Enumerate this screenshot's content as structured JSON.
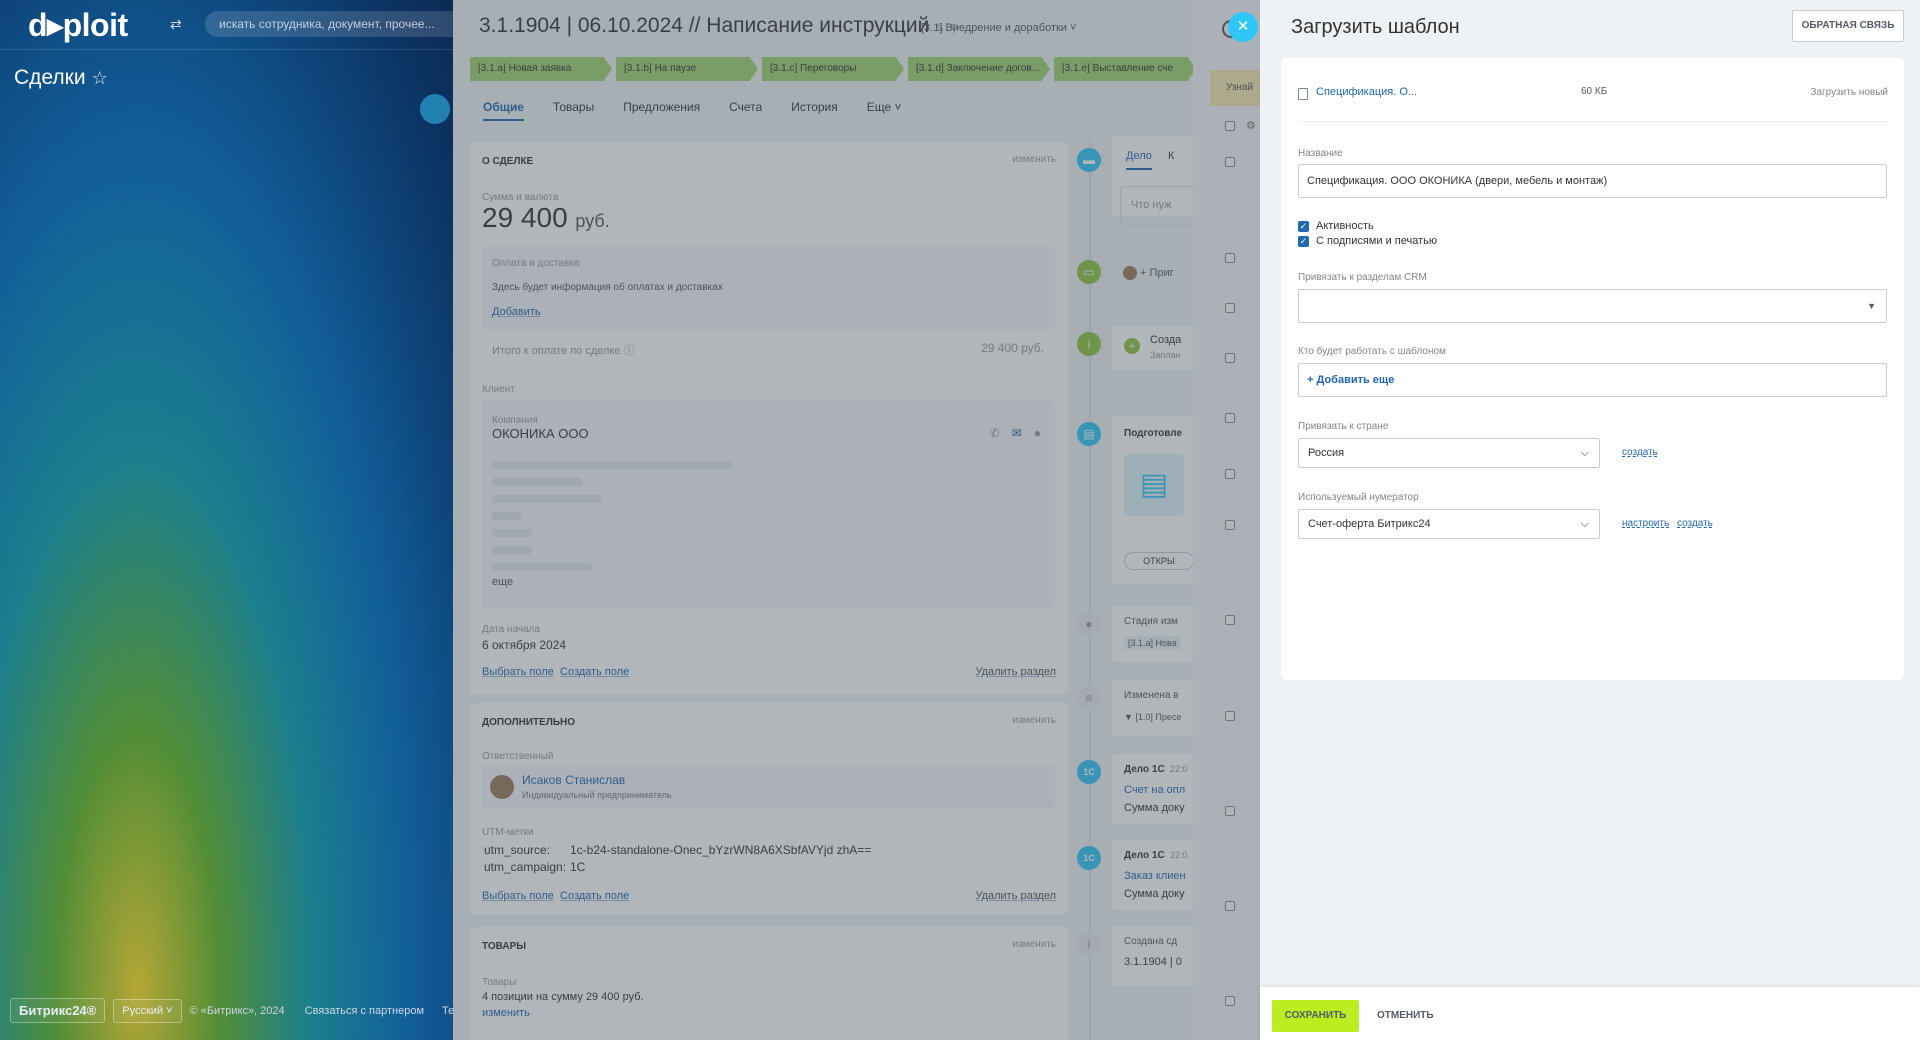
{
  "left": {
    "logo": "d▸ploit",
    "search_placeholder": "искать сотрудника, документ, прочее...",
    "page_title": "Сделки",
    "footer": {
      "brand": "Битрикс24®",
      "lang": "Русский",
      "copyright": "© «Битрикс», 2024",
      "partner": "Связаться с партнером",
      "more": "Тех"
    }
  },
  "deal": {
    "title": "3.1.1904 | 06.10.2024 // Написание инструкций",
    "category": "[3.1] Внедрение и доработки",
    "stages": [
      "[3.1.a] Новая заявка",
      "[3.1.b] На паузе",
      "[3.1.c] Переговоры",
      "[3.1.d] Заключение догов...",
      "[3.1.e] Выставление сче"
    ],
    "tabs": [
      "Общие",
      "Товары",
      "Предложения",
      "Счета",
      "История",
      "Еще"
    ],
    "about": {
      "header": "О СДЕЛКЕ",
      "edit": "изменить",
      "sum_label": "Сумма и валюта",
      "sum_value": "29 400",
      "sum_currency": "руб.",
      "payment_label": "Оплата и доставка",
      "payment_text": "Здесь будет информация об оплатах и доставках",
      "payment_add": "Добавить",
      "total_label": "Итого к оплате по сделке",
      "total_value": "29 400 руб.",
      "client_label": "Клиент",
      "company_label": "Компания",
      "company_name": "ОКОНИКА ООО",
      "more": "еще",
      "start_label": "Дата начала",
      "start_value": "6 октября 2024",
      "choose_field": "Выбрать поле",
      "create_field": "Создать поле",
      "delete_section": "Удалить раздел"
    },
    "extra": {
      "header": "ДОПОЛНИТЕЛЬНО",
      "edit": "изменить",
      "responsible_label": "Ответственный",
      "responsible_name": "Исаков Станислав",
      "responsible_role": "Индивидуальный предприниматель",
      "utm_label": "UTM-метки",
      "utm_source_key": "utm_source:",
      "utm_source_val": "1c-b24-standalone-Onec_bYzrWN8A6XSbfAVYjd zhA==",
      "utm_campaign_key": "utm_campaign:",
      "utm_campaign_val": "1C",
      "choose_field": "Выбрать поле",
      "create_field": "Создать поле",
      "delete_section": "Удалить раздел"
    },
    "goods": {
      "header": "ТОВАРЫ",
      "edit": "изменить",
      "label": "Товары",
      "summary": "4 позиции на сумму 29 400 руб.",
      "change": "изменить"
    },
    "timeline": {
      "tab1": "Дело",
      "tab2": "К",
      "input_ph": "Что нуж",
      "invite": "Приг",
      "create": "Созда",
      "planned": "Заплан",
      "prep": "Подготовле",
      "open": "ОТКРЫ",
      "stage_changed": "Стадия изм",
      "stage_tag": "[3.1.a] Нова",
      "changed": "Изменена в",
      "changed_val": "[1.0] Пресе",
      "case1": "Дело 1С",
      "case1_time": "22:0",
      "case1_link": "Счет на опл",
      "case1_text": "Сумма доку",
      "case2": "Дело 1С",
      "case2_time": "22:0",
      "case2_link": "Заказ клиен",
      "case2_text": "Сумма доку",
      "created": "Создана сд",
      "created_val": "3.1.1904 | 0"
    }
  },
  "mid": {
    "hint": "Узнай"
  },
  "panel": {
    "title": "Загрузить шаблон",
    "feedback": "ОБРАТНАЯ СВЯЗЬ",
    "file": {
      "name": "Спецификация. О...",
      "size": "60 КБ",
      "upload_new": "Загрузить новый"
    },
    "name_label": "Название",
    "name_value": "Спецификация. ООО ОКОНИКА (двери, мебель и монтаж)",
    "active_label": "Активность",
    "stamp_label": "С подписями и печатью",
    "crm_label": "Привязать к разделам CRM",
    "users_label": "Кто будет работать с шаблоном",
    "add_more": "+ Добавить еще",
    "country_label": "Привязать к стране",
    "country_value": "Россия",
    "country_create": "создать",
    "numerator_label": "Используемый нумератор",
    "numerator_value": "Счет-оферта Битрикс24",
    "numerator_setup": "настроить",
    "numerator_create": "создать"
  },
  "actions": {
    "save": "СОХРАНИТЬ",
    "cancel": "ОТМЕНИТЬ"
  }
}
